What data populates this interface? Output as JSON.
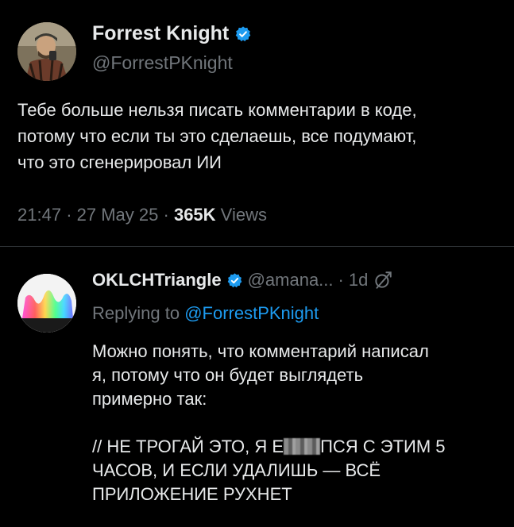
{
  "tweet": {
    "author_name": "Forrest Knight",
    "author_handle": "@ForrestPKnight",
    "verified": true,
    "text_lines": [
      "Тебе больше нельзя писать комментарии в коде,",
      "потому что если ты это сделаешь, все подумают,",
      "что это сгенерировал ИИ"
    ],
    "time": "21:47",
    "date": "27 May 25",
    "separator": "·",
    "views_count": "365K",
    "views_label": "Views"
  },
  "reply": {
    "author_name": "OKLCHTriangle",
    "author_handle": "@amana...",
    "separator": "·",
    "time": "1d",
    "replying_prefix": "Replying to",
    "replying_to": "@ForrestPKnight",
    "text_lines": [
      "Можно понять, что комментарий написал",
      "я, потому что он будет выглядеть",
      "примерно так:"
    ],
    "code_line_1_before": "// НЕ ТРОГАЙ ЭТО, Я Е",
    "code_line_1_after": "ПСЯ С ЭТИМ 5",
    "code_lines_rest": [
      "ЧАСОВ, И ЕСЛИ УДАЛИШЬ — ВСЁ",
      "ПРИЛОЖЕНИЕ РУХНЕТ"
    ]
  },
  "icons": {
    "verified_badge": "verified-badge-icon",
    "grok": "grok-icon"
  },
  "colors": {
    "background": "#000000",
    "text_primary": "#e7e9ea",
    "text_secondary": "#71767b",
    "link": "#1d9bf0",
    "divider": "#2f3336"
  }
}
